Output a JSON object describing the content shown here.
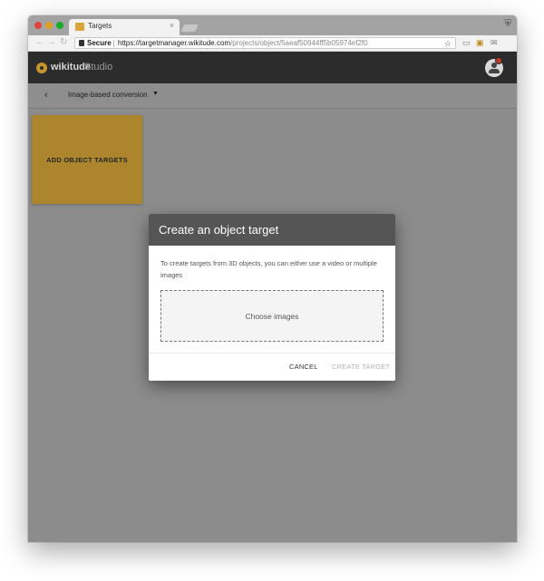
{
  "browser": {
    "tab_title": "Targets",
    "tab_close": "×",
    "incognito_icon": "⛨",
    "nav_back": "←",
    "nav_forward": "→",
    "nav_reload": "↻",
    "secure_label": "Secure",
    "url_host": "https://targetmanager.wikitude.com",
    "url_path": "/projects/object/5aeaf50944ff5b05974ef2f0",
    "star_icon": "☆",
    "ext_cast": "▭",
    "ext_lock": "▣",
    "ext_mail": "✉"
  },
  "app": {
    "logo_text": "wikitude",
    "logo_studio": "Studio",
    "brand_color": "#c8952b",
    "header_bg": "#2c2c2c"
  },
  "subnav": {
    "back_icon": "‹",
    "title": "Image-based conversion",
    "caret_icon": "▼"
  },
  "targets": {
    "add_label": "ADD OBJECT TARGETS"
  },
  "modal": {
    "title": "Create an object target",
    "description": "To create targets from 3D objects, you can either use a video or multiple images",
    "dropzone_label": "Choose images",
    "cancel_label": "CANCEL",
    "create_label": "CREATE TARGET"
  }
}
